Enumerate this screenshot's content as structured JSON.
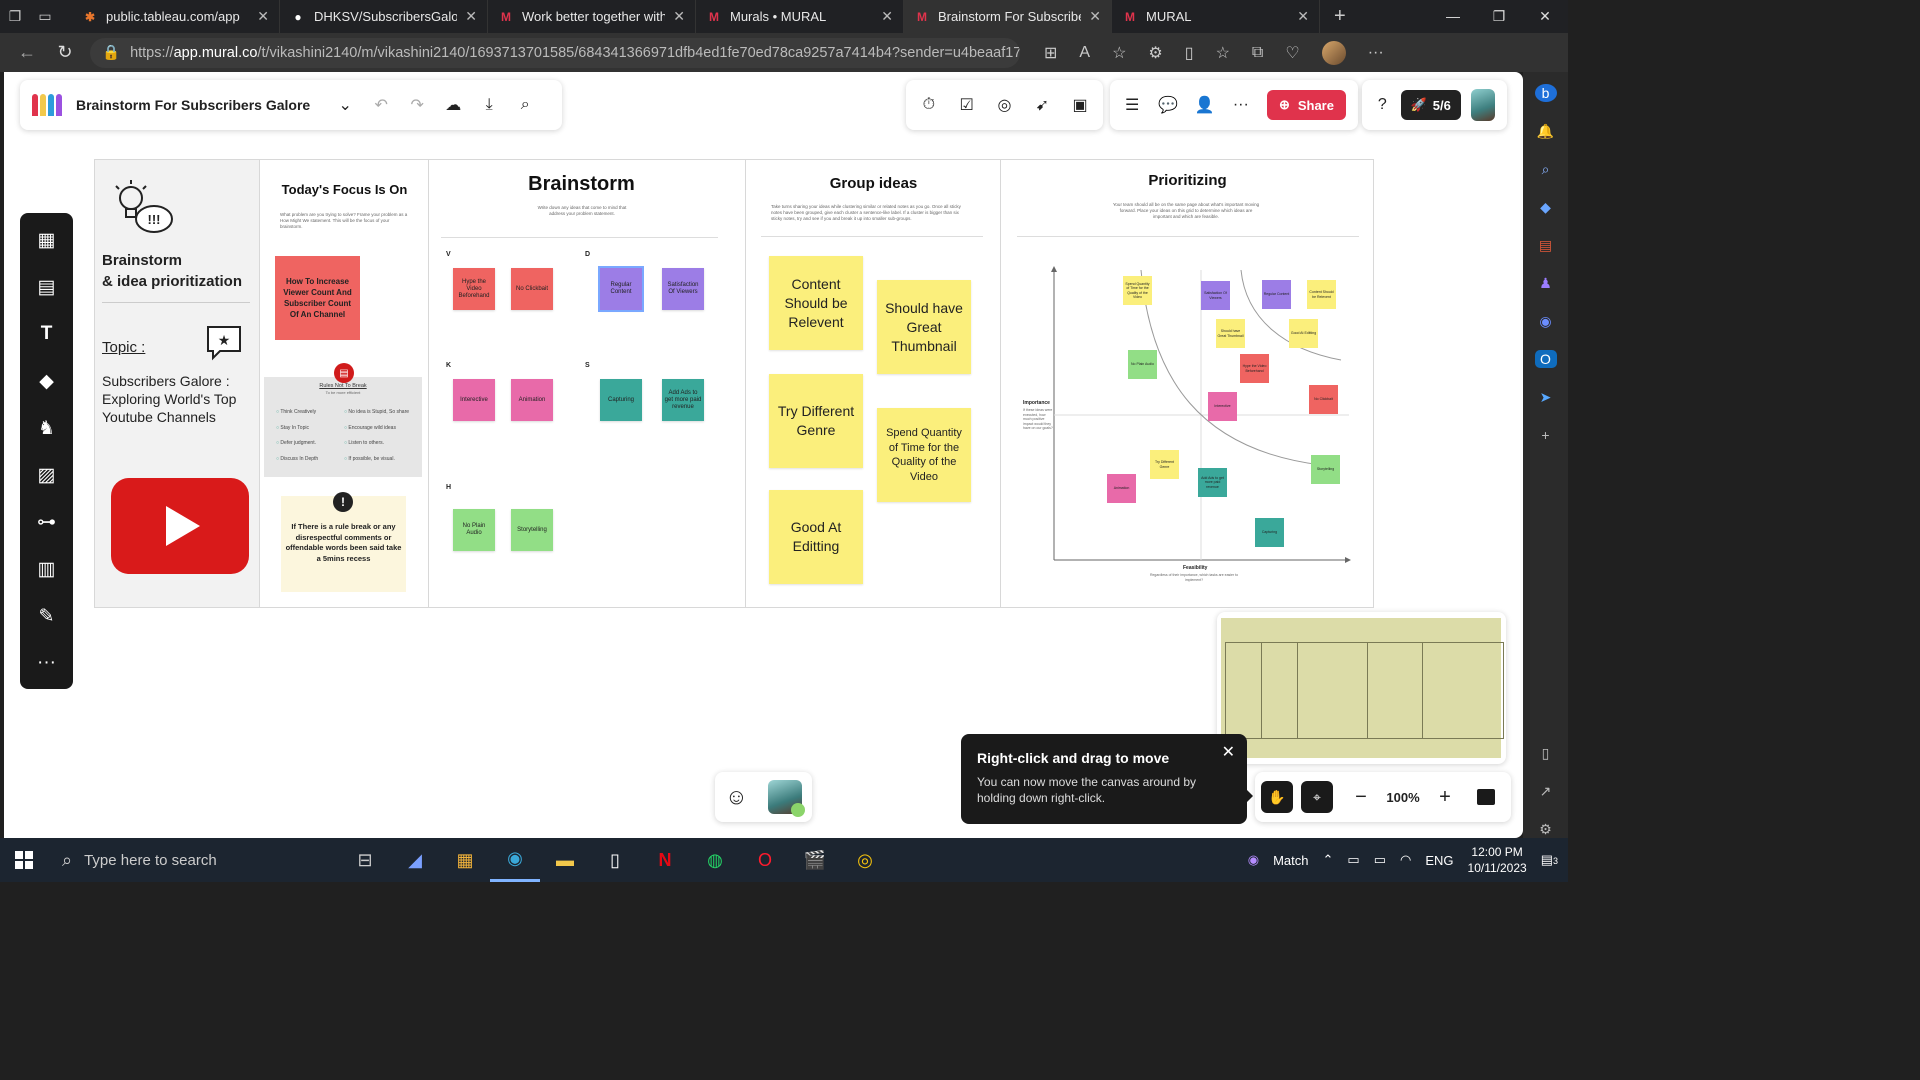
{
  "browser": {
    "tabs": [
      {
        "title": "public.tableau.com/app",
        "icon": "tableau-icon",
        "active": false
      },
      {
        "title": "DHKSV/SubscribersGalore",
        "icon": "github-icon",
        "active": false
      },
      {
        "title": "Work better together with",
        "icon": "mural-icon",
        "active": false
      },
      {
        "title": "Murals • MURAL",
        "icon": "mural-icon",
        "active": false
      },
      {
        "title": "Brainstorm For Subscribers",
        "icon": "mural-icon",
        "active": true
      },
      {
        "title": "MURAL",
        "icon": "mural-icon",
        "active": false
      }
    ],
    "url_prefix": "https://",
    "url_host": "app.mural.co",
    "url_path": "/t/vikashini2140/m/vikashini2140/1693713701585/684341366971dfb4ed1fe70ed78ca9257a7414b4?sender=u4beaaf171d1..."
  },
  "mural": {
    "title": "Brainstorm For Subscribers Galore",
    "share_label": "Share",
    "rocket_count": "5/6",
    "zoom": "100%",
    "toast": {
      "title": "Right-click and drag to move",
      "body": "You can now move the canvas around by holding down right-click."
    }
  },
  "board": {
    "col1": {
      "title_line1": "Brainstorm",
      "title_line2": "& idea prioritization",
      "topic_label": "Topic :",
      "topic_text": "Subscribers Galore : Exploring World's Top Youtube Channels"
    },
    "col2": {
      "title": "Today's Focus Is On",
      "desc": "What problem are you trying to solve? Frame your problem as a How Might We statement. This will be the focus of your brainstorm.",
      "focus_note": "How To Increase Viewer Count And Subscriber Count Of An Channel",
      "rules_title": "Rules Not To Break",
      "rules_sub": "To be more efficient",
      "rules": [
        "Think Creatively",
        "No idea is Stupid, So share",
        "Stay In Topic",
        "Encourage wild ideas",
        "Defer judgment.",
        "Listen to others.",
        "Discuss In Depth",
        "If possible, be visual."
      ],
      "note": "If There is a rule break or any disrespectful comments or offendable words been said take a 5mins recess"
    },
    "col3": {
      "title": "Brainstorm",
      "desc": "Write down any ideas that come to mind that address your problem statement.",
      "groups": [
        {
          "letter": "V",
          "notes": [
            {
              "text": "Hype the Video Beforehand",
              "color": "red"
            },
            {
              "text": "No Clickbait",
              "color": "red"
            }
          ]
        },
        {
          "letter": "D",
          "notes": [
            {
              "text": "Regular Content",
              "color": "purple"
            },
            {
              "text": "Satisfaction Of Viewers",
              "color": "purple"
            }
          ]
        },
        {
          "letter": "K",
          "notes": [
            {
              "text": "Interective",
              "color": "pink"
            },
            {
              "text": "Animation",
              "color": "pink"
            }
          ]
        },
        {
          "letter": "S",
          "notes": [
            {
              "text": "Capturing",
              "color": "teal"
            },
            {
              "text": "Add Ads to get more paid revenue",
              "color": "teal"
            }
          ]
        },
        {
          "letter": "H",
          "notes": [
            {
              "text": "No Plain Audio",
              "color": "green"
            },
            {
              "text": "Storytelling",
              "color": "green"
            }
          ]
        }
      ]
    },
    "col4": {
      "title": "Group ideas",
      "desc": "Take turns sharing your ideas while clustering similar or related notes as you go. Once all sticky notes have been grouped, give each cluster a sentence-like label. If a cluster is bigger than six sticky notes, try and see if you and break it up into smaller sub-groups.",
      "notes": [
        "Content Should be Relevent",
        "Should have Great Thumbnail",
        "Try Different Genre",
        "Spend Quantity of Time for the Quality of the Video",
        "Good At Editting"
      ]
    },
    "col5": {
      "title": "Prioritizing",
      "desc": "Your team should all be on the same page about what's important moving forward. Place your ideas on this grid to determine which ideas are important and which are feasible.",
      "y_label": "Importance",
      "y_desc": "If these ideas were executed, how much positive impact would they have on our goals?",
      "x_label": "Feasibility",
      "x_desc": "Regardless of their importance, which tasks are easier to implement?",
      "notes": [
        {
          "text": "Spend Quantity of Time for the Quality of the Video",
          "color": "yellow"
        },
        {
          "text": "Satisfaction Of Viewers",
          "color": "purple"
        },
        {
          "text": "Regular Content",
          "color": "purple"
        },
        {
          "text": "Content Should be Relevent",
          "color": "yellow"
        },
        {
          "text": "Should have Great Thumbnail",
          "color": "yellow"
        },
        {
          "text": "Good At Editting",
          "color": "yellow"
        },
        {
          "text": "No Plain Audio",
          "color": "green"
        },
        {
          "text": "Hype the Video Beforehand",
          "color": "red"
        },
        {
          "text": "Interective",
          "color": "pink"
        },
        {
          "text": "No Clickbait",
          "color": "red"
        },
        {
          "text": "Try Different Genre",
          "color": "yellow"
        },
        {
          "text": "Add Ads to get more paid revenue",
          "color": "teal"
        },
        {
          "text": "Storytelling",
          "color": "green"
        },
        {
          "text": "Animation",
          "color": "pink"
        },
        {
          "text": "Capturing",
          "color": "teal"
        }
      ]
    }
  },
  "taskbar": {
    "search_placeholder": "Type here to search",
    "match_label": "Match",
    "lang": "ENG",
    "time": "12:00 PM",
    "date": "10/11/2023",
    "notif_count": "3"
  }
}
